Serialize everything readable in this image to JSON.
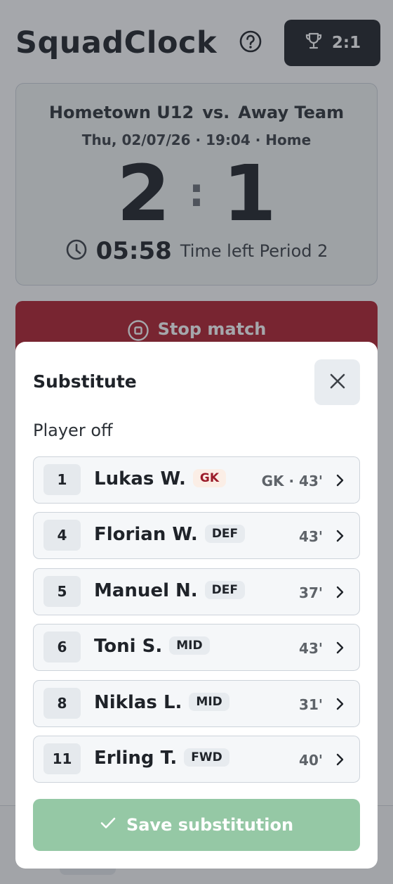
{
  "app": {
    "title": "SquadClock",
    "score_chip": "2:1"
  },
  "match": {
    "home_team": "Hometown U12",
    "vs": "vs.",
    "away_team": "Away Team",
    "meta": "Thu, 02/07/26 · 19:04 · Home",
    "home_score": "2",
    "away_score": "1",
    "colon": ":",
    "timer": "05:58",
    "timer_label": "Time left Period 2"
  },
  "stop_button": {
    "label": "Stop match"
  },
  "modal": {
    "title": "Substitute",
    "section_label": "Player off",
    "save_label": "Save substitution",
    "players": [
      {
        "number": "1",
        "name": "Lukas W.",
        "position": "GK",
        "minutes": "GK · 43'"
      },
      {
        "number": "4",
        "name": "Florian W.",
        "position": "DEF",
        "minutes": "43'"
      },
      {
        "number": "5",
        "name": "Manuel N.",
        "position": "DEF",
        "minutes": "37'"
      },
      {
        "number": "6",
        "name": "Toni S.",
        "position": "MID",
        "minutes": "43'"
      },
      {
        "number": "8",
        "name": "Niklas L.",
        "position": "MID",
        "minutes": "31'"
      },
      {
        "number": "11",
        "name": "Erling T.",
        "position": "FWD",
        "minutes": "40'"
      }
    ]
  },
  "colors": {
    "dark": "#1f2329",
    "stop_red": "#b11f2d",
    "save_green": "#95c8a5",
    "gk_badge_text": "#9b1c2a"
  },
  "icons": [
    "help-icon",
    "trophy-icon",
    "clock-icon",
    "stop-icon",
    "close-icon",
    "chevron-right-icon",
    "check-icon"
  ]
}
